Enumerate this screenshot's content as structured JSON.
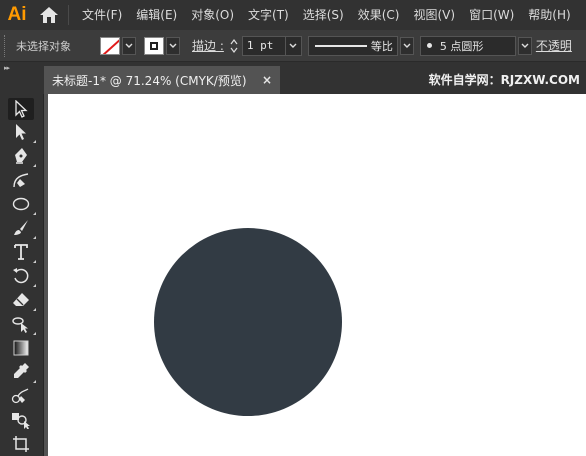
{
  "app": {
    "logo_text": "Ai"
  },
  "menu": {
    "items": [
      {
        "label": "文件(F)"
      },
      {
        "label": "编辑(E)"
      },
      {
        "label": "对象(O)"
      },
      {
        "label": "文字(T)"
      },
      {
        "label": "选择(S)"
      },
      {
        "label": "效果(C)"
      },
      {
        "label": "视图(V)"
      },
      {
        "label": "窗口(W)"
      },
      {
        "label": "帮助(H)"
      }
    ]
  },
  "controlbar": {
    "selection_label": "未选择对象",
    "stroke_label": "描边 :",
    "stroke_weight": "1 pt",
    "profile_label": "等比",
    "brush_label": "5 点圆形",
    "opacity_label": "不透明"
  },
  "document": {
    "tab_title": "未标题-1* @ 71.24% (CMYK/预览)",
    "close_symbol": "×",
    "watermark": "软件自学网：RJZXW.COM"
  },
  "canvas": {
    "background": "#ffffff",
    "circle_fill": "#323b44"
  },
  "toolbar": {
    "tools": [
      "selection-tool-icon",
      "direct-selection-tool-icon",
      "pen-tool-icon",
      "curvature-tool-icon",
      "ellipse-tool-icon",
      "paintbrush-tool-icon",
      "type-tool-icon",
      "rotate-tool-icon",
      "eraser-tool-icon",
      "free-transform-tool-icon",
      "gradient-tool-icon",
      "eyedropper-tool-icon",
      "blend-tool-icon",
      "shape-builder-tool-icon",
      "artboard-tool-icon"
    ]
  }
}
